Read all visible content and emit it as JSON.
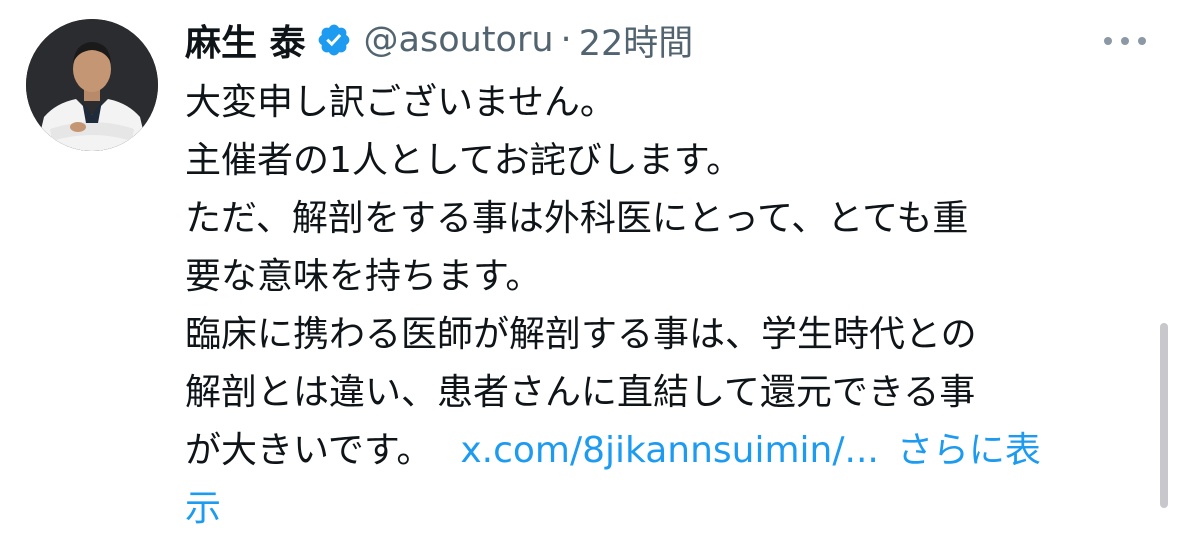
{
  "author": {
    "display_name": "麻生 泰",
    "handle": "@asoutoru",
    "separator": "·",
    "time": "22時間",
    "verified": true,
    "verified_color": "#1d9bf0"
  },
  "tweet": {
    "lines": [
      "大変申し訳ございません。",
      "主催者の1人としてお詫びします。",
      "ただ、解剖をする事は外科医にとって、とても重",
      "要な意味を持ちます。",
      "臨床に携わる医師が解剖する事は、学生時代との",
      "解剖とは違い、患者さんに直結して還元できる事",
      "が大きいです。"
    ],
    "link_text": "x.com/8jikannsuimin/...",
    "show_more_line1": "さらに表",
    "show_more_line2": "示"
  },
  "colors": {
    "text": "#0f1419",
    "secondary": "#536471",
    "link": "#1d9bf0"
  },
  "icons": {
    "avatar": "profile-photo",
    "verified": "verified-badge-icon",
    "more": "more-options-icon"
  }
}
